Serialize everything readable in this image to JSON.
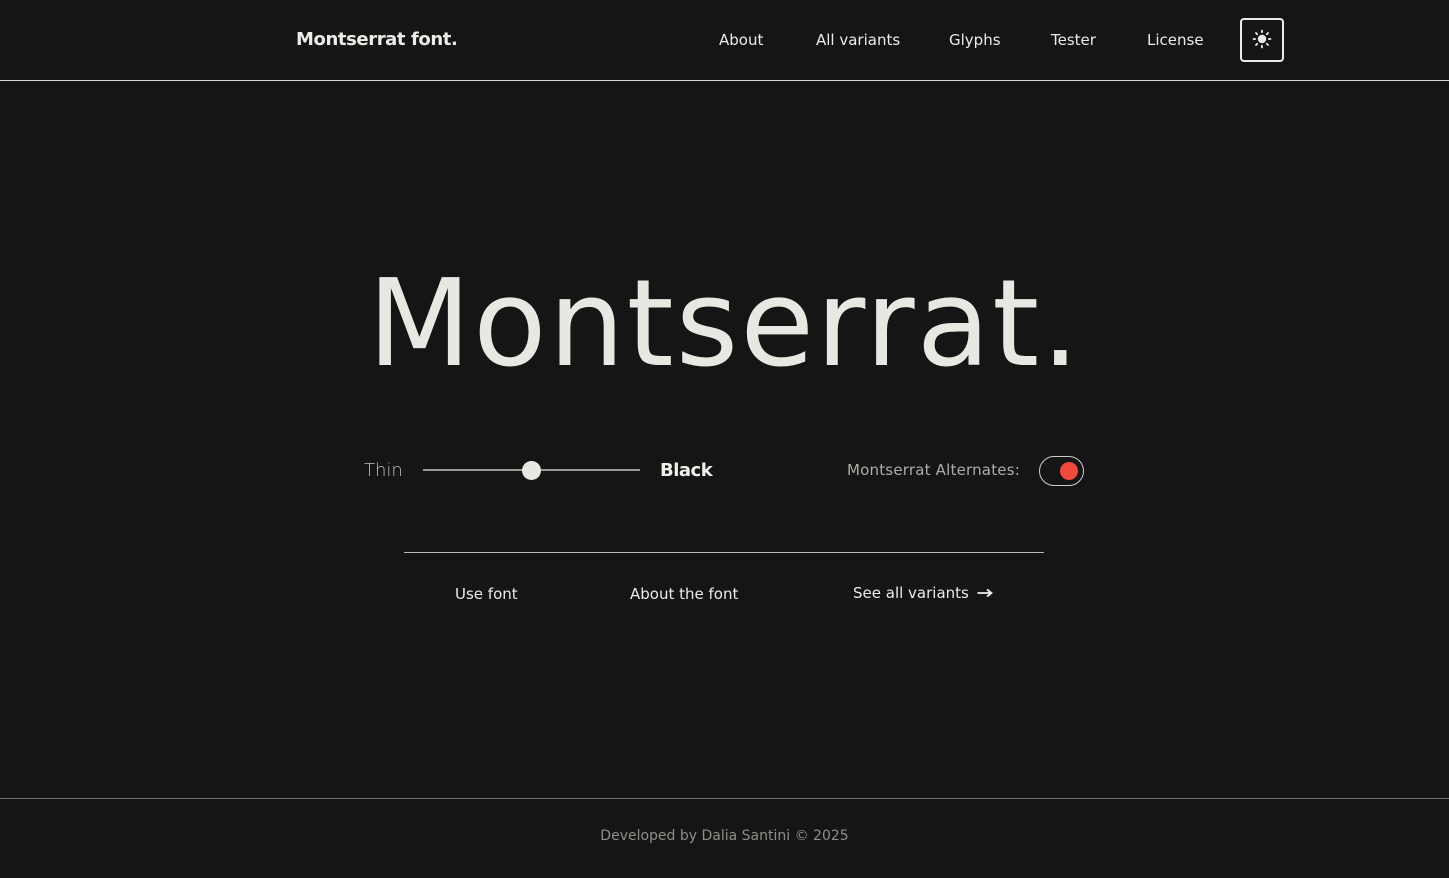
{
  "header": {
    "brand": "Montserrat font.",
    "nav": [
      {
        "label": "About"
      },
      {
        "label": "All variants"
      },
      {
        "label": "Glyphs"
      },
      {
        "label": "Tester"
      },
      {
        "label": "License"
      }
    ],
    "theme_toggle_icon": "sun-icon"
  },
  "hero": {
    "title": "Montserrat."
  },
  "weight_control": {
    "min_label": "Thin",
    "max_label": "Black",
    "value_fraction": 0.5
  },
  "alternates": {
    "label": "Montserrat Alternates:",
    "enabled": true,
    "accent_color": "#f0483a"
  },
  "actions": {
    "use_font": "Use font",
    "about_font": "About the font",
    "see_variants": "See all variants",
    "see_variants_icon": "arrow-right-icon"
  },
  "footer": {
    "text": "Developed by Dalia Santini © 2025"
  }
}
